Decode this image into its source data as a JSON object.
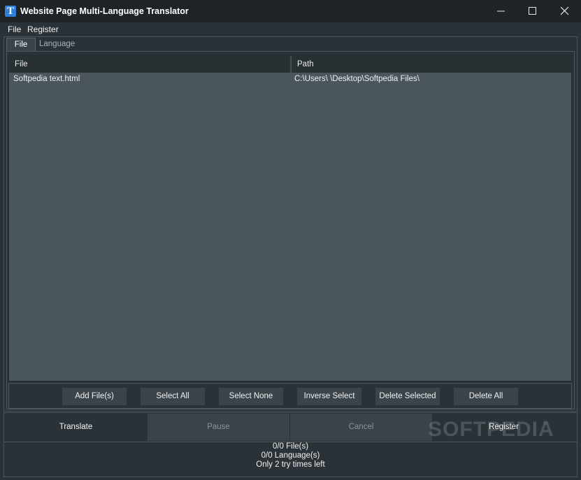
{
  "window": {
    "title": "Website Page Multi-Language Translator",
    "icon_letter": "T"
  },
  "menu": {
    "file": "File",
    "register": "Register"
  },
  "tabs": {
    "file": "File",
    "language": "Language"
  },
  "table": {
    "headers": {
      "file": "File",
      "path": "Path"
    },
    "rows": [
      {
        "file": "Softpedia text.html",
        "path": "C:\\Users\\      \\Desktop\\Softpedia Files\\"
      }
    ]
  },
  "buttons": {
    "add_files": "Add File(s)",
    "select_all": "Select All",
    "select_none": "Select None",
    "inverse_select": "Inverse Select",
    "delete_selected": "Delete Selected",
    "delete_all": "Delete All"
  },
  "actions": {
    "translate": "Translate",
    "pause": "Pause",
    "cancel": "Cancel",
    "register": "Register"
  },
  "status": {
    "files": "0/0 File(s)",
    "languages": "0/0 Language(s)",
    "tries": "Only 2 try times left"
  },
  "watermark": {
    "text": "SOFTPEDIA",
    "mark": "®"
  },
  "colors": {
    "background": "#2b3237",
    "table_body": "#4a555c",
    "header": "#283034",
    "button": "#3b444a",
    "app_icon": "#2f7ed8"
  }
}
